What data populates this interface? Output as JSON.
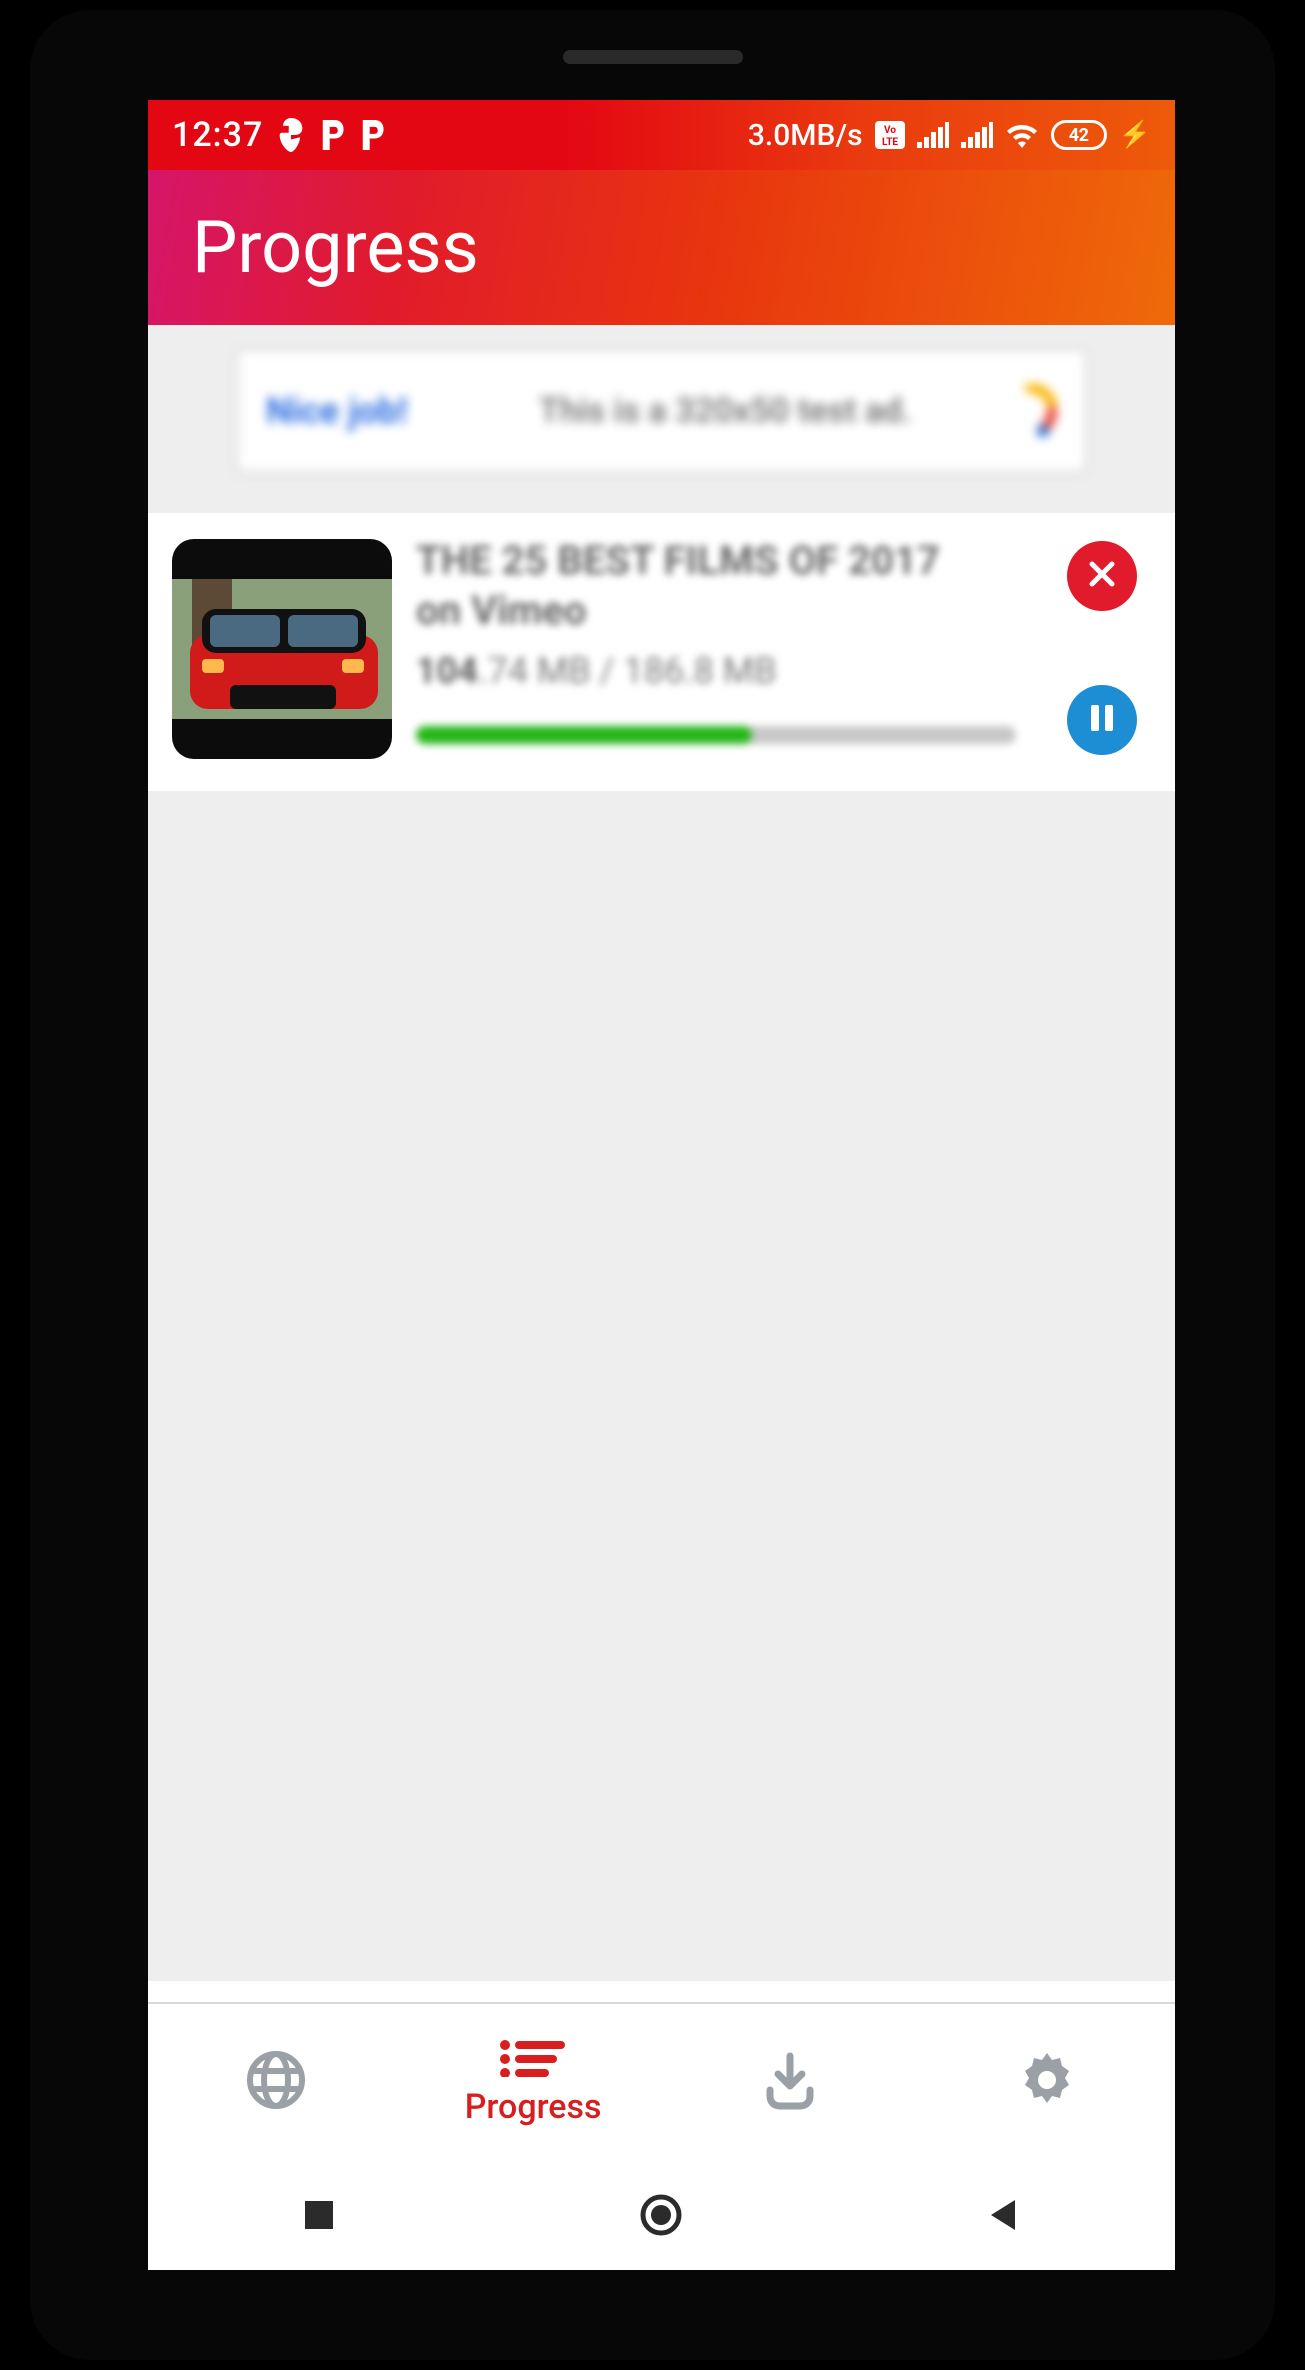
{
  "status_bar": {
    "time": "12:37",
    "data_rate": "3.0MB/s",
    "volte_badge": "Vo LTE",
    "battery_percent": "42",
    "charging": true,
    "signal_bars": 2,
    "wifi": true,
    "notif_icon_1": "swiggy-icon",
    "notif_icon_2": "p-icon",
    "notif_icon_3": "p-icon"
  },
  "header": {
    "title": "Progress"
  },
  "ad": {
    "cta": "Nice job!",
    "text": "This is a 320x50 test ad.",
    "logo_name": "admob-logo"
  },
  "download": {
    "title": "THE 25 BEST FILMS OF 2017",
    "subtitle": "on Vimeo",
    "size_done_prefix": "104",
    "size_done_suffix": ".74 MB",
    "size_sep": " / ",
    "size_total": "186.8 MB",
    "progress_percent": 56,
    "thumbnail_name": "video-thumbnail-red-car",
    "colors": {
      "progress": "#26b71a",
      "cancel": "#e11b2b",
      "pause": "#1d8ed4"
    }
  },
  "tabs": {
    "items": [
      {
        "name": "browser",
        "label": "",
        "active": false,
        "icon": "globe-icon"
      },
      {
        "name": "progress",
        "label": "Progress",
        "active": true,
        "icon": "list-icon"
      },
      {
        "name": "downloads",
        "label": "",
        "active": false,
        "icon": "download-icon"
      },
      {
        "name": "settings",
        "label": "",
        "active": false,
        "icon": "gear-icon"
      }
    ]
  },
  "softnav": {
    "recent": "recent-apps",
    "home": "home",
    "back": "back"
  }
}
